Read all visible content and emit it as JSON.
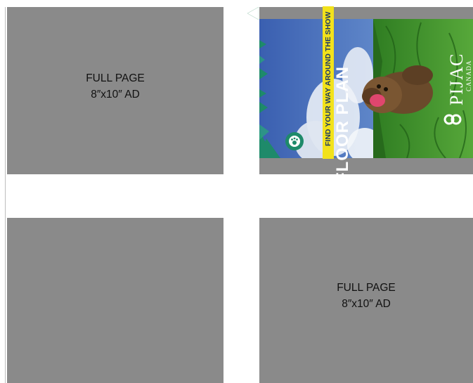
{
  "panels": {
    "top_left": {
      "line1": "FULL PAGE",
      "line2": "8″x10″ AD"
    },
    "bottom_right": {
      "line1": "FULL PAGE",
      "line2": "8″x10″ AD"
    }
  },
  "cover": {
    "title": "FLOOR PLAN",
    "tagline": "FIND YOUR WAY AROUND THE SHOW",
    "brand": "PIJAC",
    "brand_sub": "CANADA",
    "colors": {
      "teal": "#1e8a6a",
      "yellow": "#f2e21b",
      "sky": "#3f66b8",
      "grass": "#3e8f2a"
    },
    "icons": [
      "map-pin-paw-icon",
      "pijac-logo-icon"
    ]
  }
}
